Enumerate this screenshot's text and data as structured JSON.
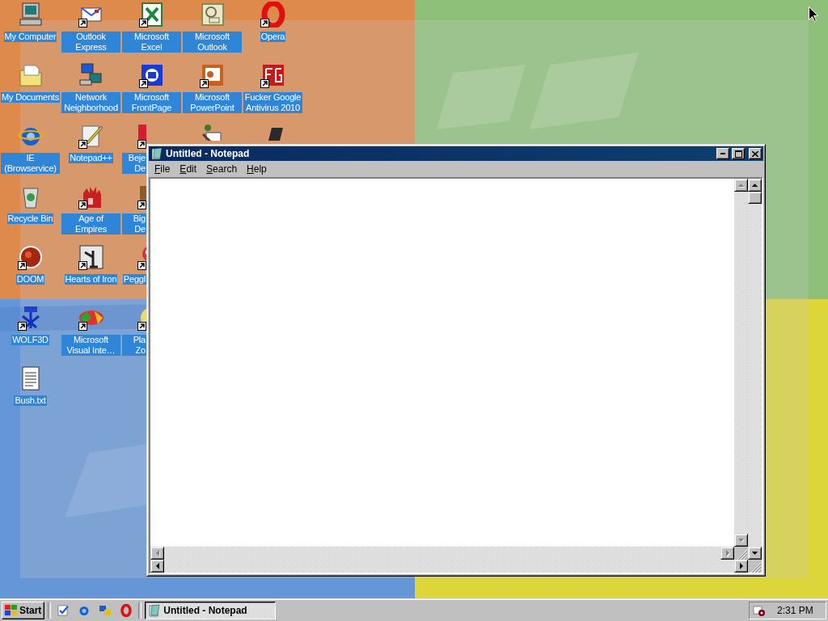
{
  "desktop": {
    "icon_columns": [
      [
        {
          "kind": "full",
          "label": "My Computer",
          "shortcut": false,
          "selected": true
        },
        {
          "kind": "full",
          "label": "My Documents",
          "shortcut": false,
          "selected": true
        },
        {
          "kind": "full",
          "label": "IE (Browservice)",
          "shortcut": false,
          "selected": true
        },
        {
          "kind": "full",
          "label": "Recycle Bin",
          "shortcut": false,
          "selected": true
        },
        {
          "kind": "full",
          "label": "DOOM",
          "shortcut": true,
          "selected": true
        },
        {
          "kind": "full",
          "label": "WOLF3D",
          "shortcut": true,
          "selected": true
        },
        {
          "kind": "full",
          "label": "Bush.txt",
          "shortcut": false,
          "selected": true
        }
      ],
      [
        {
          "kind": "full",
          "label": "Outlook Express",
          "shortcut": true,
          "selected": true
        },
        {
          "kind": "full",
          "label": "Network Neighborhood",
          "shortcut": false,
          "selected": true
        },
        {
          "kind": "full",
          "label": "Notepad++",
          "shortcut": true,
          "selected": true
        },
        {
          "kind": "full",
          "label": "Age of Empires",
          "shortcut": true,
          "selected": true
        },
        {
          "kind": "full",
          "label": "Hearts of Iron",
          "shortcut": true,
          "selected": true
        },
        {
          "kind": "full",
          "label": "Microsoft Visual Inte…",
          "shortcut": true,
          "selected": true
        }
      ],
      [
        {
          "kind": "full",
          "label": "Microsoft Excel",
          "shortcut": true,
          "selected": true
        },
        {
          "kind": "full",
          "label": "Microsoft FrontPage",
          "shortcut": true,
          "selected": true
        },
        {
          "kind": "clipped",
          "label": "Beje De",
          "shortcut": true,
          "selected": true
        },
        {
          "kind": "clipped",
          "label": "Big De",
          "shortcut": true,
          "selected": true
        },
        {
          "kind": "clipped",
          "label": "Peggl",
          "shortcut": true,
          "selected": true
        },
        {
          "kind": "clipped",
          "label": "Pla Zo",
          "shortcut": true,
          "selected": true
        }
      ],
      [
        {
          "kind": "full",
          "label": "Microsoft Outlook",
          "shortcut": false,
          "selected": true
        },
        {
          "kind": "full",
          "label": "Microsoft PowerPoint",
          "shortcut": true,
          "selected": true
        },
        {
          "kind": "covered"
        }
      ],
      [
        {
          "kind": "full",
          "label": "Opera",
          "shortcut": true,
          "selected": true
        },
        {
          "kind": "full",
          "label": "Fucker Google Antivirus 2010",
          "shortcut": true,
          "selected": true
        },
        {
          "kind": "covered"
        }
      ]
    ]
  },
  "window": {
    "title": "Untitled - Notepad",
    "active": true,
    "menu": [
      "File",
      "Edit",
      "Search",
      "Help"
    ],
    "scrollbars": [
      {
        "kind": "inner_vertical",
        "disabled": true
      },
      {
        "kind": "outer_vertical",
        "disabled": false
      },
      {
        "kind": "inner_horizontal",
        "disabled": true
      },
      {
        "kind": "outer_horizontal",
        "disabled": false
      }
    ]
  },
  "taskbar": {
    "start": "Start",
    "tasks": [
      {
        "label": "Untitled - Notepad",
        "selected": true
      }
    ],
    "clock": "2:31 PM"
  }
}
